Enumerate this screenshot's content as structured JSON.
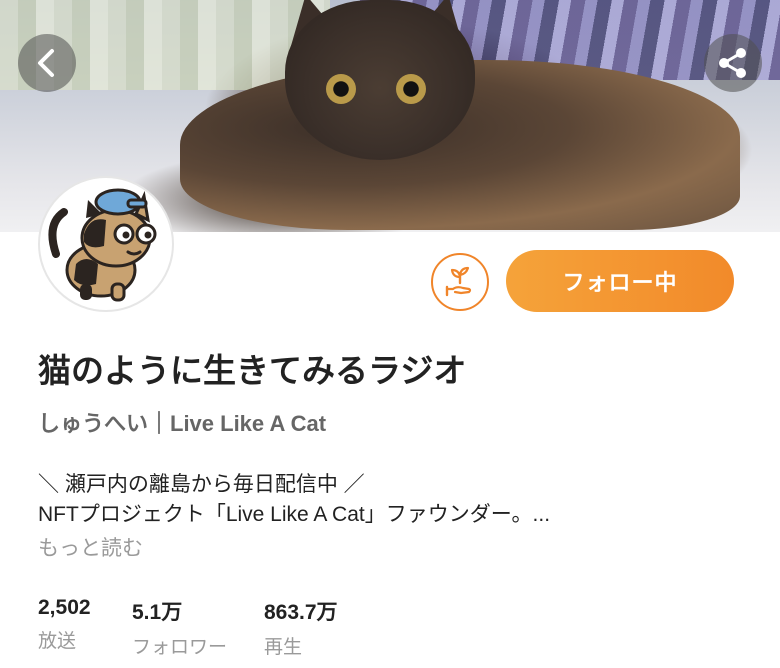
{
  "header": {
    "back_icon": "chevron-left-icon",
    "share_icon": "share-icon"
  },
  "profile": {
    "avatar_icon": "cat-character-avatar",
    "support_icon": "plant-in-hand-icon",
    "follow_label": "フォロー中",
    "title": "猫のように生きてみるラジオ",
    "author": "しゅうへい｜Live Like A Cat",
    "description_line1": "＼ 瀬戸内の離島から毎日配信中 ／",
    "description_line2": "NFTプロジェクト「Live Like A Cat」ファウンダー。...",
    "more_label": "もっと読む"
  },
  "stats": [
    {
      "value": "2,502",
      "label": "放送"
    },
    {
      "value": "5.1万",
      "label": "フォロワー"
    },
    {
      "value": "863.7万",
      "label": "再生"
    }
  ],
  "colors": {
    "accent": "#f28a2a",
    "accent_light": "#f5a33a",
    "muted_text": "#9a9a9a"
  }
}
